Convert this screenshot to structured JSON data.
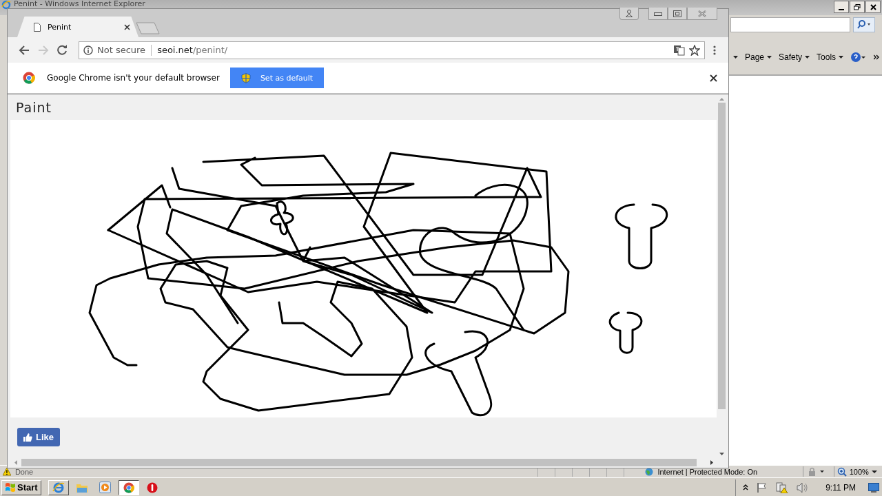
{
  "ie_window": {
    "title": "Penint - Windows Internet Explorer",
    "command_bar": [
      {
        "label": "Page"
      },
      {
        "label": "Safety"
      },
      {
        "label": "Tools"
      }
    ],
    "status_bar": {
      "status": "Done",
      "zone": "Internet | Protected Mode: On",
      "zoom": "100%"
    }
  },
  "chrome": {
    "tabs": [
      {
        "title": "Penint",
        "selected": true
      }
    ],
    "address": {
      "security": "Not secure",
      "host": "seoi.net",
      "path": "/penint/"
    },
    "infobar": {
      "message": "Google Chrome isn't your default browser",
      "button": "Set as default"
    },
    "page": {
      "heading": "Paint",
      "like_button": "Like"
    }
  },
  "taskbar": {
    "start": "Start",
    "apps": [
      {
        "kind": "ie",
        "running": true,
        "selected": false
      },
      {
        "kind": "explorer",
        "running": false,
        "selected": false
      },
      {
        "kind": "media",
        "running": false,
        "selected": false
      },
      {
        "kind": "chrome",
        "running": true,
        "selected": true
      },
      {
        "kind": "stop",
        "running": false,
        "selected": false
      }
    ],
    "clock": "9:11 PM"
  }
}
